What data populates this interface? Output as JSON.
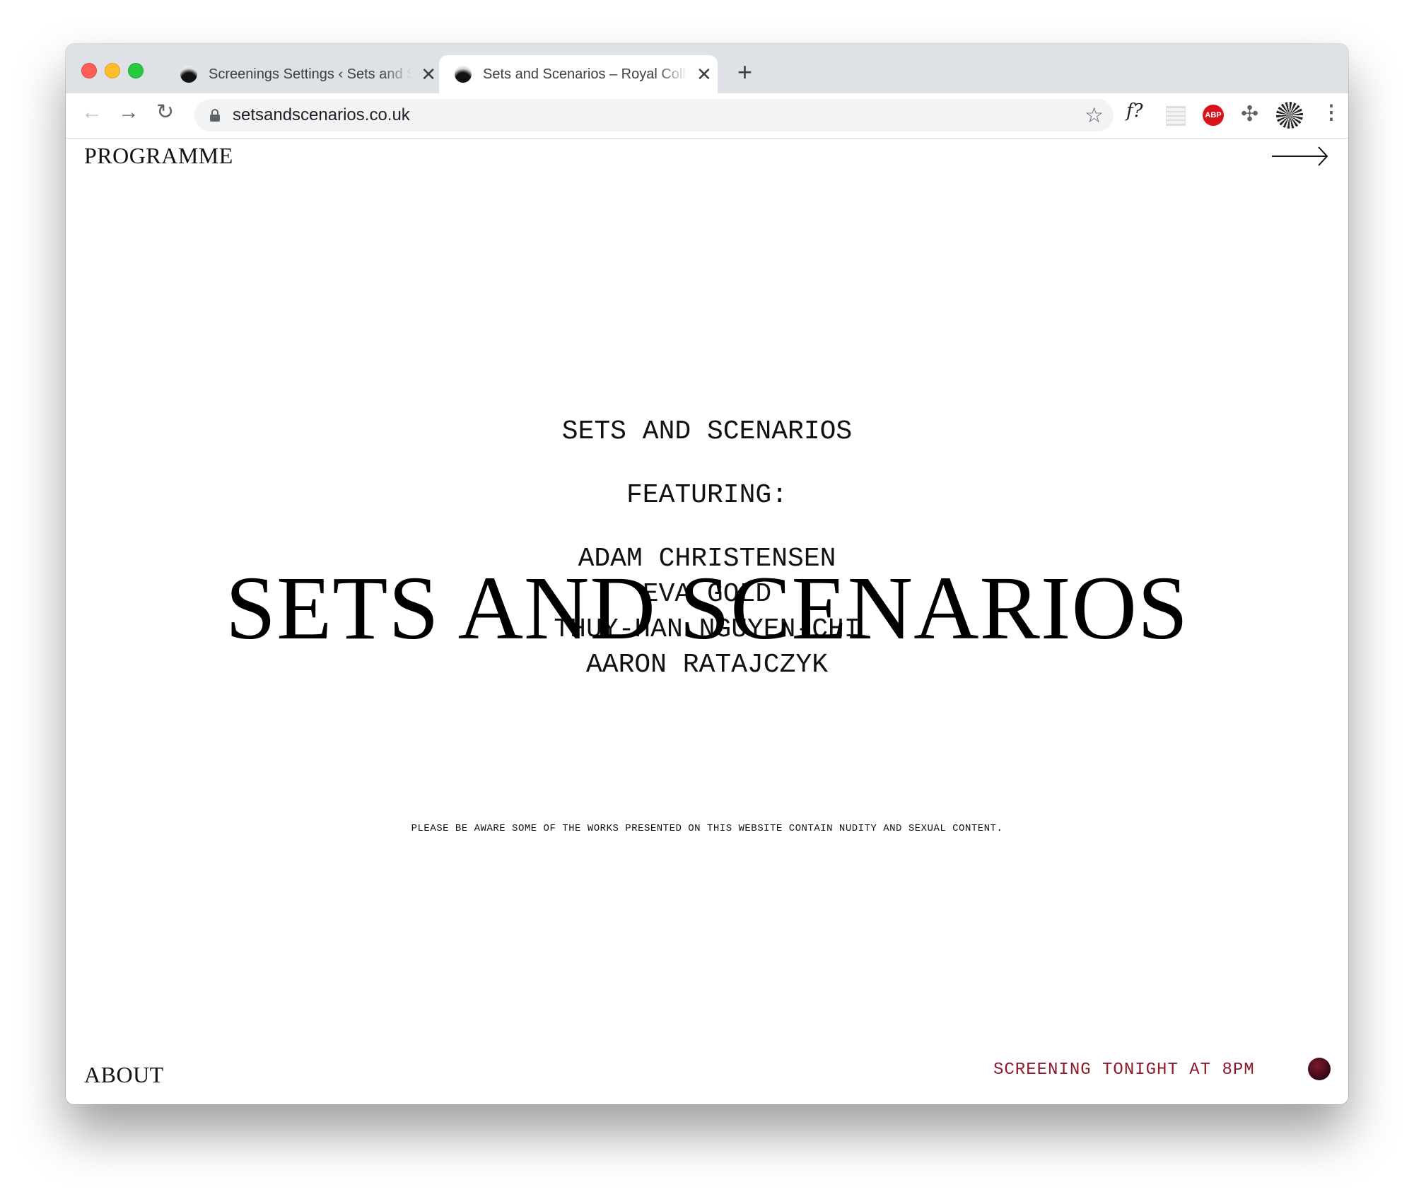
{
  "browser": {
    "tabs": [
      {
        "title": "Screenings Settings ‹ Sets and Scenarios",
        "active": false
      },
      {
        "title": "Sets and Scenarios – Royal College",
        "active": true
      }
    ],
    "url": "setsandscenarios.co.uk",
    "extensions": [
      {
        "icon": "font-question-icon",
        "label": "f?"
      },
      {
        "icon": "grid-extension-icon",
        "label": ""
      },
      {
        "icon": "adblock-plus-icon",
        "label": "ABP"
      },
      {
        "icon": "puzzle-icon",
        "label": ""
      },
      {
        "icon": "profile-avatar-icon",
        "label": ""
      }
    ]
  },
  "page": {
    "nav_programme": "PROGRAMME",
    "nav_about": "ABOUT",
    "lines": [
      "SETS AND SCENARIOS",
      "FEATURING:"
    ],
    "artists": [
      "ADAM CHRISTENSEN",
      "EVA GOLD",
      "THUY-HAN NGUYEN-CHI",
      "AARON RATAJCZYK"
    ],
    "big_title": "SETS AND SCENARIOS",
    "warning": "PLEASE BE AWARE SOME OF THE WORKS PRESENTED ON THIS WEBSITE CONTAIN NUDITY AND SEXUAL CONTENT.",
    "screening": "SCREENING TONIGHT AT 8PM",
    "accent_color": "#8b1a2b"
  }
}
